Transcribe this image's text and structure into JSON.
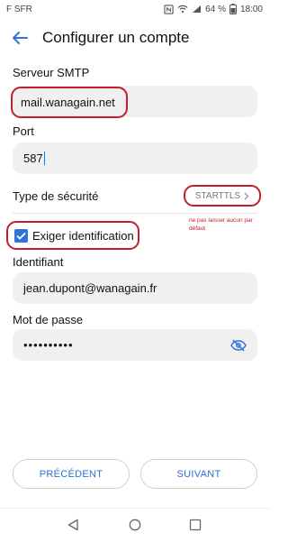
{
  "status_bar": {
    "carrier": "F SFR",
    "battery": "64 %",
    "time": "18:00",
    "icons": [
      "nfc-icon",
      "wifi-icon",
      "signal-icon",
      "battery-icon"
    ]
  },
  "header": {
    "back_icon": "arrow-left-icon",
    "title": "Configurer un compte"
  },
  "form": {
    "smtp_label": "Serveur SMTP",
    "smtp_value": "mail.wanagain.net",
    "port_label": "Port",
    "port_value": "587",
    "security_label": "Type de sécurité",
    "security_value": "STARTTLS",
    "require_auth_label": "Exiger identification",
    "require_auth_checked": true,
    "note": "ne pas laisser aucun par défaut",
    "username_label": "Identifiant",
    "username_value": "jean.dupont@wanagain.fr",
    "password_label": "Mot de passe",
    "password_value": "••••••••••"
  },
  "actions": {
    "previous": "PRÉCÉDENT",
    "next": "SUIVANT"
  },
  "colors": {
    "accent": "#2f74d8",
    "annotation": "#c0202c",
    "field_bg": "#f0f0f0"
  }
}
